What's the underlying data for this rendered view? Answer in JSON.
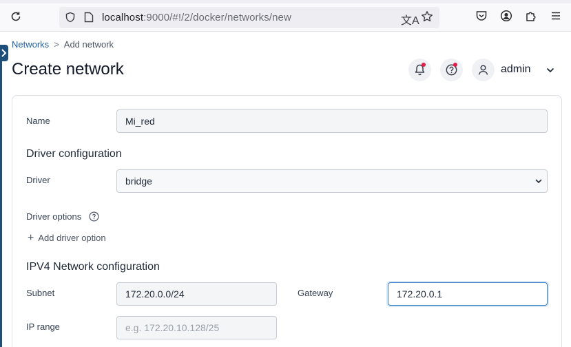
{
  "browser": {
    "url_host": "localhost",
    "url_rest": ":9000/#!/2/docker/networks/new"
  },
  "breadcrumb": {
    "parent": "Networks",
    "separator": ">",
    "current": "Add network"
  },
  "header": {
    "title": "Create network",
    "user": "admin"
  },
  "form": {
    "name_label": "Name",
    "name_value": "Mi_red",
    "driver_section": "Driver configuration",
    "driver_label": "Driver",
    "driver_value": "bridge",
    "driver_options_label": "Driver options",
    "add_driver_option": "Add driver option",
    "ipv4_section": "IPV4 Network configuration",
    "subnet_label": "Subnet",
    "subnet_value": "172.20.0.0/24",
    "gateway_label": "Gateway",
    "gateway_value": "172.20.0.1",
    "ip_range_label": "IP range",
    "ip_range_placeholder": "e.g. 172.20.10.128/25"
  },
  "colors": {
    "accent": "#1f5fa0",
    "sidebar": "#1e4f7a",
    "notification_dot": "#e11d48"
  }
}
